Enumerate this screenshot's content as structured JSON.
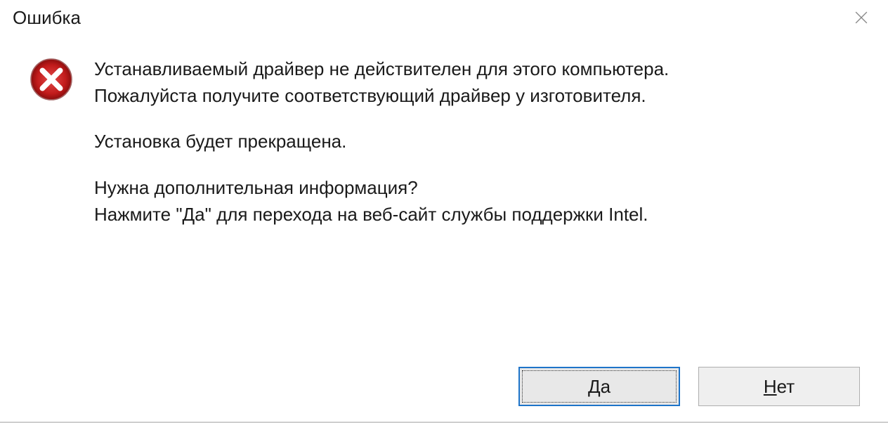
{
  "dialog": {
    "title": "Ошибка",
    "message": {
      "line1": "Устанавливаемый драйвер не действителен для этого компьютера.",
      "line2": "Пожалуйста получите соответствующий драйвер у изготовителя.",
      "line3": "Установка будет прекращена.",
      "line4": "Нужна дополнительная информация?",
      "line5": "Нажмите \"Да\" для перехода на веб-сайт службы поддержки Intel."
    },
    "buttons": {
      "yes_mnemonic": "Д",
      "yes_rest": "а",
      "no_mnemonic": "Н",
      "no_rest": "ет"
    },
    "icon": "error-icon"
  }
}
